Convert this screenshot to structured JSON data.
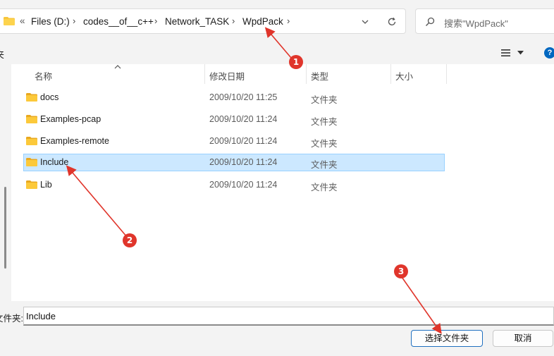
{
  "address": {
    "overflow": "«",
    "crumbs": [
      "Files (D:)",
      "codes__of__c++",
      "Network_TASK",
      "WpdPack"
    ],
    "separator": "›"
  },
  "search": {
    "placeholder": "搜索\"WpdPack\""
  },
  "toolbar": {
    "left_text": "夹",
    "help_label": "?"
  },
  "columns": {
    "name": "名称",
    "modified": "修改日期",
    "type": "类型",
    "size": "大小"
  },
  "rows": [
    {
      "name": "docs",
      "modified": "2009/10/20 11:25",
      "type": "文件夹",
      "selected": false
    },
    {
      "name": "Examples-pcap",
      "modified": "2009/10/20 11:24",
      "type": "文件夹",
      "selected": false
    },
    {
      "name": "Examples-remote",
      "modified": "2009/10/20 11:24",
      "type": "文件夹",
      "selected": false
    },
    {
      "name": "Include",
      "modified": "2009/10/20 11:24",
      "type": "文件夹",
      "selected": true
    },
    {
      "name": "Lib",
      "modified": "2009/10/20 11:24",
      "type": "文件夹",
      "selected": false
    }
  ],
  "bottom": {
    "folder_label": "文件夹:",
    "folder_value": "Include",
    "select_button": "选择文件夹",
    "cancel_button": "取消"
  },
  "annotations": [
    "1",
    "2",
    "3"
  ],
  "colors": {
    "accent": "#0067c0",
    "selection": "#cce8ff",
    "annotation": "#e0352b",
    "folder": "#f8c63c"
  }
}
